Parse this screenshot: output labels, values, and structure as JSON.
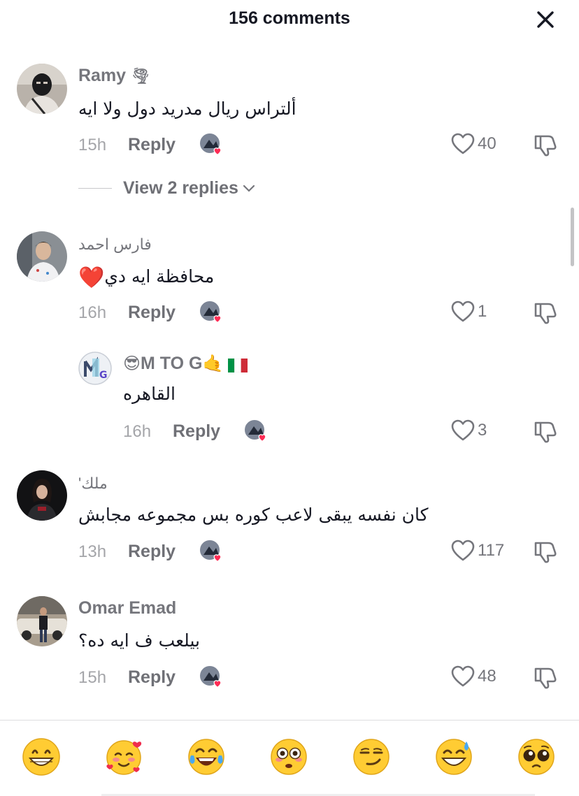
{
  "header": {
    "title": "156 comments",
    "close_icon": "close-icon"
  },
  "comments": [
    {
      "username": "Ramy",
      "username_suffix": "🌪",
      "text": "ألتراس ريال مدريد دول ولا ايه",
      "time": "15h",
      "reply_label": "Reply",
      "likes": "40"
    },
    {
      "username": "فارس احمد",
      "text": "محافظة ايه دي",
      "text_emoji": "❤️",
      "time": "16h",
      "reply_label": "Reply",
      "likes": "1"
    },
    {
      "username_prefix": "😎",
      "username": "M TO G",
      "username_suffix": "🤙",
      "text": "القاهره",
      "time": "16h",
      "reply_label": "Reply",
      "likes": "3",
      "avatar_letters": "M TO G"
    },
    {
      "username": "ملك'",
      "text": "كان نفسه يبقى لاعب كوره بس مجموعه مجابش",
      "time": "13h",
      "reply_label": "Reply",
      "likes": "117"
    },
    {
      "username": "Omar Emad",
      "text": "بيلعب ف ايه ده؟",
      "time": "15h",
      "reply_label": "Reply",
      "likes": "48"
    }
  ],
  "view_replies": {
    "label": "View 2 replies"
  },
  "emoji_bar": [
    "😁",
    "🥰",
    "😂",
    "😳",
    "😏",
    "😅",
    "🥺"
  ],
  "colors": {
    "like_red": "#fe2c55",
    "text": "#161823",
    "muted": "#75767c"
  }
}
